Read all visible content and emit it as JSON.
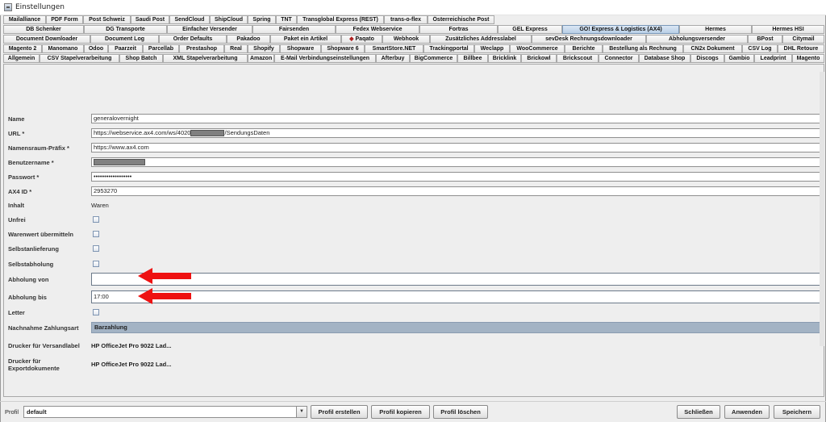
{
  "window": {
    "title": "Einstellungen"
  },
  "tabs": {
    "row1": [
      "Mailalliance",
      "PDF Form",
      "Post Schweiz",
      "Saudi Post",
      "SendCloud",
      "ShipCloud",
      "Spring",
      "TNT",
      "Transglobal Express (REST)",
      "trans-o-flex",
      "Österreichische Post"
    ],
    "row2": [
      "DB Schenker",
      "DG Transporte",
      "Einfacher Versender",
      "Fairsenden",
      "Fedex Webservice",
      "Fortras",
      "GEL Express",
      "GO! Express & Logistics (AX4)",
      "Hermes",
      "Hermes HSI"
    ],
    "row3": [
      "Document Downloader",
      "Document Log",
      "Order Defaults",
      "Pakadoo",
      "Paket ein Artikel",
      "Paqato",
      "Webhook",
      "Zusätzliches Addresslabel",
      "sevDesk Rechnungsdownloader",
      "Abholungsversender",
      "BPost",
      "Citymail"
    ],
    "row4": [
      "Magento 2",
      "Manomano",
      "Odoo",
      "Paarzeit",
      "Parcellab",
      "Prestashop",
      "Real",
      "Shopify",
      "Shopware",
      "Shopware 6",
      "SmartStore.NET",
      "Trackingportal",
      "Weclapp",
      "WooCommerce",
      "Berichte",
      "Bestellung als Rechnung",
      "CN2x Dokument",
      "CSV Log",
      "DHL Retoure"
    ],
    "row5": [
      "Allgemein",
      "CSV Stapelverarbeitung",
      "Shop Batch",
      "XML Stapelverarbeitung",
      "Amazon",
      "E-Mail Verbindungseinstellungen",
      "Afterbuy",
      "BigCommerce",
      "Billbee",
      "Bricklink",
      "Brickowl",
      "Brickscout",
      "Connector",
      "Database Shop",
      "Discogs",
      "Gambio",
      "Leadprint",
      "Magento"
    ]
  },
  "form": {
    "name": {
      "label": "Name",
      "value": "generalovernight"
    },
    "url": {
      "label": "URL *",
      "value_prefix": "https://webservice.ax4.com/ws/4020",
      "value_suffix": "/SendungsDaten"
    },
    "namespace": {
      "label": "Namensraum-Präfix *",
      "value": "https://www.ax4.com"
    },
    "username": {
      "label": "Benutzername *"
    },
    "password": {
      "label": "Passwort *",
      "value": "••••••••••••••••••"
    },
    "ax4id": {
      "label": "AX4 ID *",
      "value": "2953270"
    },
    "inhalt": {
      "label": "Inhalt",
      "value": "Waren"
    },
    "unfrei": {
      "label": "Unfrei"
    },
    "warenwert": {
      "label": "Warenwert übermitteln"
    },
    "selbstanlieferung": {
      "label": "Selbstanlieferung"
    },
    "selbstabholung": {
      "label": "Selbstabholung"
    },
    "abholung_von": {
      "label": "Abholung von",
      "value": ""
    },
    "abholung_bis": {
      "label": "Abholung bis",
      "value": "17:00"
    },
    "letter": {
      "label": "Letter"
    },
    "nachnahme": {
      "label": "Nachnahme Zahlungsart",
      "value": "Barzahlung"
    },
    "drucker_versand": {
      "label": "Drucker für Versandlabel",
      "value": "HP OfficeJet Pro 9022 Lad..."
    },
    "drucker_export": {
      "label": "Drucker für Exportdokumente",
      "value": "HP OfficeJet Pro 9022 Lad..."
    }
  },
  "footer": {
    "profile_label": "Profil",
    "profile_value": "default",
    "buttons": [
      "Profil erstellen",
      "Profil kopieren",
      "Profil löschen",
      "Schließen",
      "Anwenden",
      "Speichern"
    ]
  },
  "annotations": {
    "arrow_color": "#ee1111"
  }
}
